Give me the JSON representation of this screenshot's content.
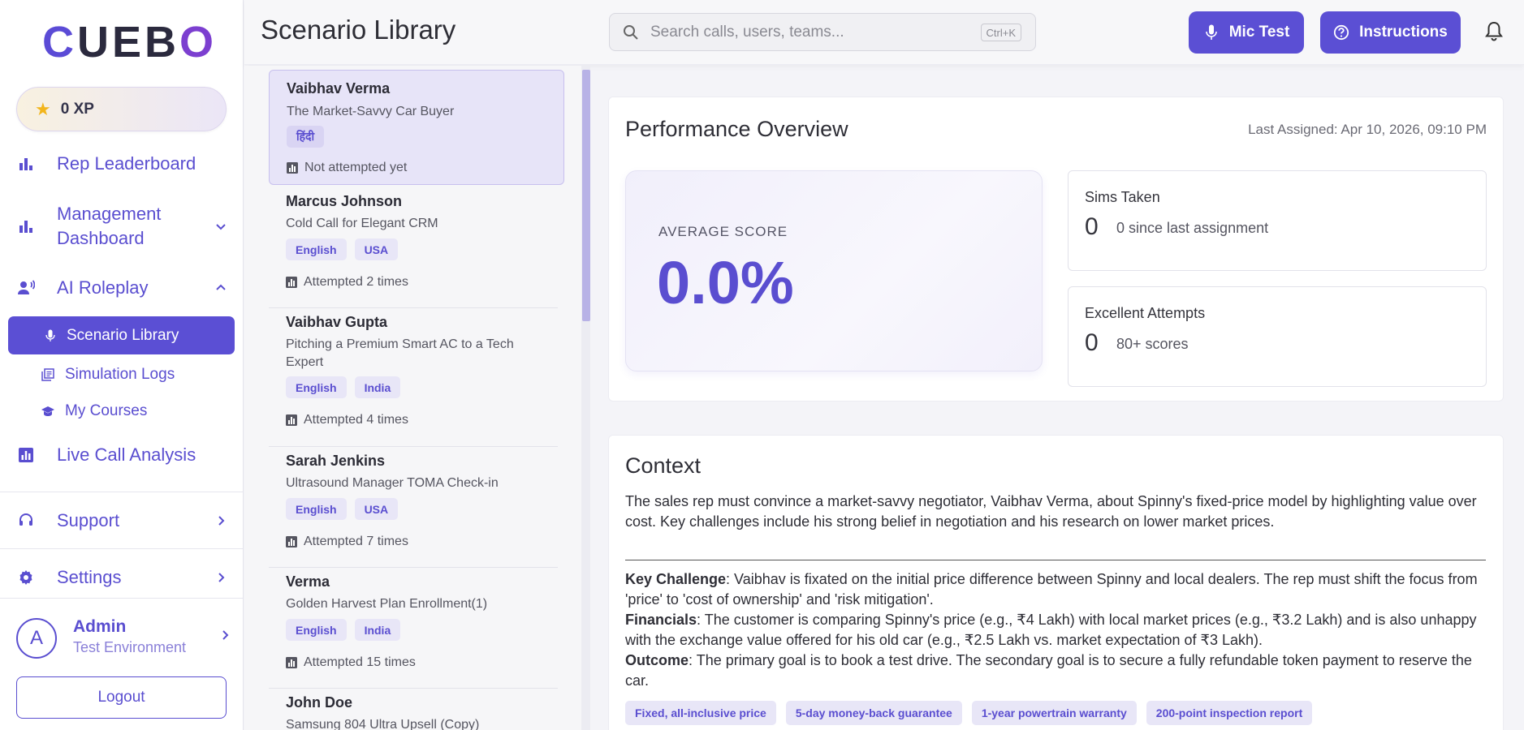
{
  "sidebar": {
    "logo": "CUEBO",
    "xp_label": "0 XP",
    "items": [
      {
        "label": "Rep Leaderboard"
      },
      {
        "label": "Management\nDashboard"
      },
      {
        "label": "AI Roleplay"
      },
      {
        "label": "Scenario Library"
      },
      {
        "label": "Simulation Logs"
      },
      {
        "label": "My Courses"
      },
      {
        "label": "Live Call Analysis"
      },
      {
        "label": "Support"
      },
      {
        "label": "Settings"
      }
    ],
    "user": {
      "initial": "A",
      "name": "Admin",
      "env": "Test Environment"
    },
    "logout_label": "Logout"
  },
  "header": {
    "title": "Scenario Library",
    "search_placeholder": "Search calls, users, teams...",
    "search_shortcut": "Ctrl+K",
    "mic_test_label": "Mic Test",
    "instructions_label": "Instructions"
  },
  "scenarios": [
    {
      "name": "Vaibhav Verma",
      "desc": "The Market-Savvy Car Buyer",
      "tags": [
        "हिंदी"
      ],
      "status": "Not attempted yet"
    },
    {
      "name": "Marcus Johnson",
      "desc": "Cold Call for Elegant CRM",
      "tags": [
        "English",
        "USA"
      ],
      "status": "Attempted 2 times"
    },
    {
      "name": "Vaibhav Gupta",
      "desc": "Pitching a Premium Smart AC to a Tech Expert",
      "tags": [
        "English",
        "India"
      ],
      "status": "Attempted 4 times"
    },
    {
      "name": "Sarah Jenkins",
      "desc": "Ultrasound Manager TOMA Check-in",
      "tags": [
        "English",
        "USA"
      ],
      "status": "Attempted 7 times"
    },
    {
      "name": "Verma",
      "desc": "Golden Harvest Plan Enrollment(1)",
      "tags": [
        "English",
        "India"
      ],
      "status": "Attempted 15 times"
    },
    {
      "name": "John Doe",
      "desc": "Samsung 804 Ultra Upsell (Copy)",
      "tags": [],
      "status": ""
    }
  ],
  "performance": {
    "title": "Performance Overview",
    "last_assigned": "Last Assigned: Apr 10, 2026, 09:10 PM",
    "avg_label": "AVERAGE SCORE",
    "avg_value": "0.0%",
    "sims_title": "Sims Taken",
    "sims_value": "0",
    "sims_note": "0 since last assignment",
    "excellent_title": "Excellent Attempts",
    "excellent_value": "0",
    "excellent_note": "80+ scores"
  },
  "context": {
    "title": "Context",
    "body": "The sales rep must convince a market-savvy negotiator, Vaibhav Verma, about Spinny's fixed-price model by highlighting value over cost. Key challenges include his strong belief in negotiation and his research on lower market prices.",
    "key_challenge_label": "Key Challenge",
    "key_challenge_text": ": Vaibhav is fixated on the initial price difference between Spinny and local dealers. The rep must shift the focus from 'price' to 'cost of ownership' and 'risk mitigation'.",
    "financials_label": "Financials",
    "financials_text": ": The customer is comparing Spinny's price (e.g., ₹4 Lakh) with local market prices (e.g., ₹3.2 Lakh) and is also unhappy with the exchange value offered for his old car (e.g., ₹2.5 Lakh vs. market expectation of ₹3 Lakh).",
    "outcome_label": "Outcome",
    "outcome_text": ": The primary goal is to book a test drive. The secondary goal is to secure a fully refundable token payment to reserve the car.",
    "tags": [
      "Fixed, all-inclusive price",
      "5-day money-back guarantee",
      "1-year powertrain warranty",
      "200-point inspection report"
    ]
  },
  "colors": {
    "accent": "#5b4fd4",
    "accent_text": "#5a4ed0",
    "star": "#f2b51b"
  }
}
